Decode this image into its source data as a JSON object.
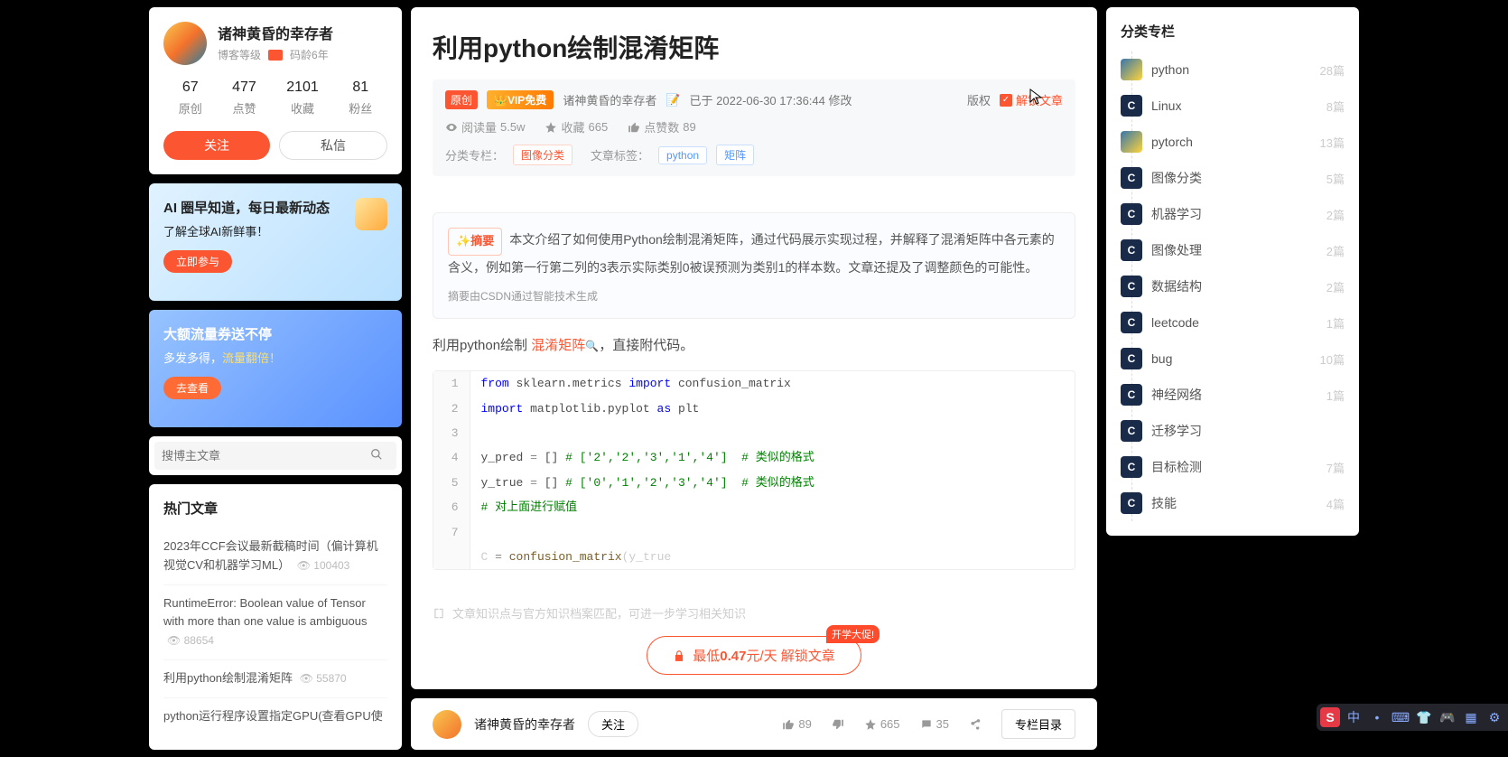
{
  "author": {
    "name": "诸神黄昏的幸存者",
    "blog_level": "博客等级",
    "code_age": "码龄6年"
  },
  "stats": [
    {
      "n": "67",
      "l": "原创"
    },
    {
      "n": "477",
      "l": "点赞"
    },
    {
      "n": "2101",
      "l": "收藏"
    },
    {
      "n": "81",
      "l": "粉丝"
    }
  ],
  "btn_follow": "关注",
  "btn_dm": "私信",
  "ad1": {
    "title": "AI 圈早知道，每日最新动态",
    "sub": "了解全球AI新鲜事！",
    "btn": "立即参与"
  },
  "ad2": {
    "title": "大额流量券送不停",
    "sub": "多发多得，",
    "highlight": "流量翻倍！",
    "btn": "去查看"
  },
  "search_placeholder": "搜博主文章",
  "hot_title": "热门文章",
  "hot": [
    {
      "t": "2023年CCF会议最新截稿时间（偏计算机视觉CV和机器学习ML）",
      "c": "100403"
    },
    {
      "t": "RuntimeError: Boolean value of Tensor with more than one value is ambiguous",
      "c": "88654"
    },
    {
      "t": "利用python绘制混淆矩阵",
      "c": "55870"
    },
    {
      "t": "python运行程序设置指定GPU(查看GPU使",
      "c": ""
    }
  ],
  "article": {
    "title": "利用python绘制混淆矩阵",
    "badge_original": "原创",
    "badge_vip": "VIP免费",
    "author": "诸神黄昏的幸存者",
    "pub_prefix": "已于",
    "pub": "2022-06-30 17:36:44 修改",
    "copyright": "版权",
    "unlock": "解锁文章",
    "read_lbl": "阅读量",
    "read_val": "5.5w",
    "fav_lbl": "收藏",
    "fav_val": "665",
    "like_lbl": "点赞数",
    "like_val": "89",
    "cat_lbl": "分类专栏：",
    "cat_tag": "图像分类",
    "tag_lbl": "文章标签：",
    "tags": [
      "python",
      "矩阵"
    ]
  },
  "summary": {
    "badge": "摘要",
    "text": "本文介绍了如何使用Python绘制混淆矩阵，通过代码展示实现过程，并解释了混淆矩阵中各元素的含义，例如第一行第二列的3表示实际类别0被误预测为类别1的样本数。文章还提及了调整颜色的可能性。",
    "foot": "摘要由CSDN通过智能技术生成"
  },
  "body_intro_pre": "利用python绘制 ",
  "body_intro_link": "混淆矩阵",
  "body_intro_post": "，直接附代码。",
  "knowledge_hint": "文章知识点与官方知识档案匹配，可进一步学习相关知识",
  "unlock_btn_pre": "最低",
  "unlock_btn_price": "0.47",
  "unlock_btn_post": "元/天 解锁文章",
  "promo": "开学大促!",
  "bottom": {
    "like": "89",
    "fav": "665",
    "cmt": "35",
    "toc": "专栏目录",
    "follow": "关注"
  },
  "cats_title": "分类专栏",
  "cats": [
    {
      "n": "python",
      "c": "28篇",
      "i": "py"
    },
    {
      "n": "Linux",
      "c": "8篇",
      "i": "c"
    },
    {
      "n": "pytorch",
      "c": "13篇",
      "i": "py"
    },
    {
      "n": "图像分类",
      "c": "5篇",
      "i": "c"
    },
    {
      "n": "机器学习",
      "c": "2篇",
      "i": "c"
    },
    {
      "n": "图像处理",
      "c": "2篇",
      "i": "c"
    },
    {
      "n": "数据结构",
      "c": "2篇",
      "i": "c"
    },
    {
      "n": "leetcode",
      "c": "1篇",
      "i": "c"
    },
    {
      "n": "bug",
      "c": "10篇",
      "i": "c"
    },
    {
      "n": "神经网络",
      "c": "1篇",
      "i": "c"
    },
    {
      "n": "迁移学习",
      "c": "",
      "i": "c"
    },
    {
      "n": "目标检测",
      "c": "7篇",
      "i": "c"
    },
    {
      "n": "技能",
      "c": "4篇",
      "i": "c"
    }
  ]
}
